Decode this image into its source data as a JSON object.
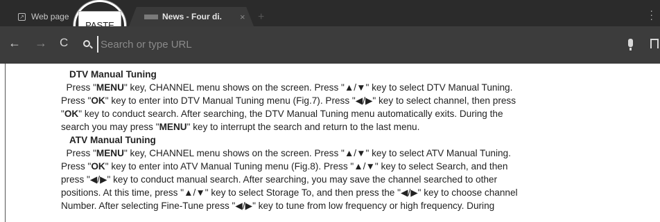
{
  "tabs": [
    {
      "label": "Web page",
      "active": false
    },
    {
      "label": "News - Four di.",
      "active": true
    }
  ],
  "tab_close_glyph": "×",
  "new_tab_glyph": "+",
  "paste_label": "PASTE",
  "toolbar": {
    "url_placeholder": "Search or type URL"
  },
  "content": {
    "dtv_heading": "DTV Manual Tuning",
    "dtv_lines": [
      [
        "  Press \"",
        "MENU",
        "\" key, CHANNEL menu shows on the screen. Press \"▲/▼\" key to select DTV Manual Tuning."
      ],
      [
        "Press \"",
        "OK",
        "\" key to enter into DTV Manual Tuning menu (Fig.7). Press \"◀/▶\" key to select channel, then press"
      ],
      [
        "\"",
        "OK",
        "\" key to conduct search. After searching, the DTV Manual Tuning menu automatically exits. During the"
      ],
      [
        "search you may press \"",
        "MENU",
        "\" key to interrupt the search and return to the last menu."
      ]
    ],
    "atv_heading": "ATV Manual Tuning",
    "atv_lines": [
      [
        "  Press \"",
        "MENU",
        "\" key, CHANNEL menu shows on the screen. Press \"▲/▼\" key to select ATV Manual Tuning."
      ],
      [
        "Press \"",
        "OK",
        "\" key to enter into ATV Manual Tuning menu (Fig.8). Press \"▲/▼\" key to select Search, and then"
      ],
      [
        "press \"◀/▶\" key to conduct manual search. After searching, you may save the channel searched to other",
        "",
        ""
      ],
      [
        "positions. At this time, press \"▲/▼\" key to select Storage To, and then press the \"◀/▶\" key to choose channel",
        "",
        ""
      ],
      [
        "Number. After selecting Fine-Tune press \"◀/▶\" key to tune from low frequency or high frequency. During",
        "",
        ""
      ]
    ]
  }
}
